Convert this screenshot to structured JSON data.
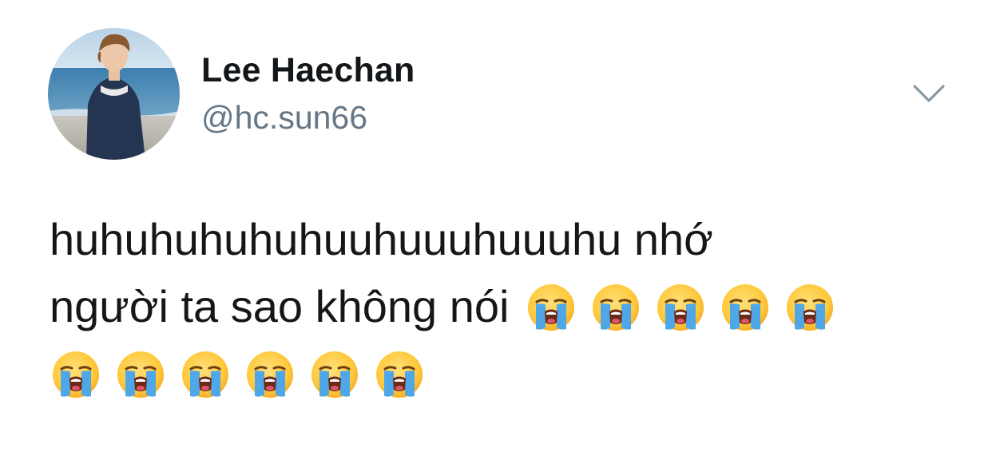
{
  "author": {
    "display_name": "Lee Haechan",
    "handle": "@hc.sun66",
    "avatar_icon": "profile-photo"
  },
  "tweet": {
    "text_line_1": "huhuhuhuhuhuuhuuuhuuuhu nhớ",
    "text_line_2": "người ta sao không nói",
    "emoji_name": "loudly-crying-face",
    "emoji_count": 11
  },
  "menu": {
    "caret_icon": "chevron-down-icon",
    "caret_color": "#8899a6"
  },
  "colors": {
    "text": "#14171a",
    "secondary": "#657786"
  }
}
